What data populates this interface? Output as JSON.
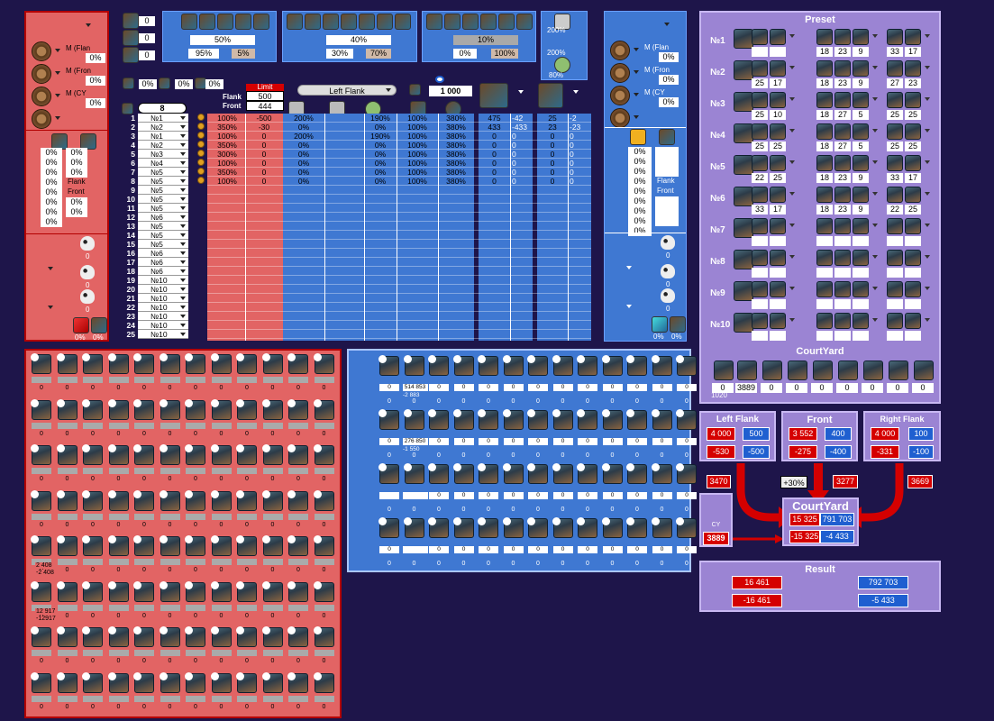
{
  "left_top": {
    "rows": [
      {
        "label": "M (Flan",
        "value": "0%"
      },
      {
        "label": "M (Fron",
        "value": "0%"
      },
      {
        "label": "M (CY",
        "value": "0%"
      }
    ]
  },
  "left_mid": {
    "rows": [
      "0%",
      "0%",
      "0%",
      "0%",
      "0%",
      "0%",
      "0%",
      "0%"
    ],
    "col2": [
      "0%",
      "0%",
      "0%",
      "Flank",
      "Front",
      "0%",
      "0%"
    ]
  },
  "left_bottom": {
    "values": [
      "0",
      "0",
      "0"
    ],
    "pcts": [
      "0%",
      "0%"
    ]
  },
  "top_counts": [
    "0",
    "0",
    "0"
  ],
  "boost": [
    {
      "pct": "50%",
      "a": "95%",
      "b": "5%"
    },
    {
      "pct": "40%",
      "a": "30%",
      "b": "70%"
    },
    {
      "pct": "10%",
      "a": "0%",
      "b": "100%"
    }
  ],
  "wall": {
    "a": "200%",
    "b": "200%",
    "c": "80%"
  },
  "small_pcts": [
    "0%",
    "0%",
    "0%",
    "0%"
  ],
  "limit": {
    "label": "Limit",
    "flank_label": "Flank",
    "flank": "500",
    "front_label": "Front",
    "front": "444"
  },
  "selector": {
    "num": "8",
    "flank": "Left Flank",
    "amount": "1 000"
  },
  "table": {
    "rows": [
      "1",
      "2",
      "3",
      "4",
      "5",
      "6",
      "7",
      "8",
      "9",
      "10",
      "11",
      "12",
      "13",
      "14",
      "15",
      "16",
      "17",
      "18",
      "19",
      "20",
      "21",
      "22",
      "23",
      "24",
      "25"
    ],
    "presets": [
      "№1",
      "№2",
      "№1",
      "№2",
      "№3",
      "№4",
      "№5",
      "№5",
      "№5",
      "№5",
      "№5",
      "№6",
      "№5",
      "№5",
      "№5",
      "№6",
      "№6",
      "№6",
      "№10",
      "№10",
      "№10",
      "№10",
      "№10",
      "№10",
      "№10"
    ],
    "c1": [
      "100%",
      "350%",
      "100%",
      "350%",
      "300%",
      "100%",
      "350%",
      "100%"
    ],
    "c2": [
      "-500",
      "-30",
      "0",
      "0",
      "0",
      "0",
      "0",
      "0"
    ],
    "c3": [
      "200%",
      "0%",
      "200%",
      "0%",
      "0%",
      "0%",
      "0%",
      "0%"
    ],
    "c4": [
      "190%",
      "0%",
      "190%",
      "0%",
      "0%",
      "0%",
      "0%",
      "0%"
    ],
    "c5": [
      "100%",
      "100%",
      "100%",
      "100%",
      "100%",
      "100%",
      "100%",
      "100%"
    ],
    "c6": [
      "380%",
      "380%",
      "380%",
      "380%",
      "380%",
      "380%",
      "380%",
      "380%"
    ],
    "c7": [
      "475",
      "433",
      "0",
      "0",
      "0",
      "0",
      "0",
      "0"
    ],
    "c8": [
      "-42",
      "-433",
      "0",
      "0",
      "0",
      "0",
      "0",
      "0"
    ],
    "c9": [
      "25",
      "23",
      "0",
      "0",
      "0",
      "0",
      "0",
      "0"
    ],
    "c10": [
      "-2",
      "-23",
      "0",
      "0",
      "0",
      "0",
      "0",
      "0"
    ]
  },
  "right_small": {
    "rows": [
      {
        "label": "M (Flan",
        "value": "0%"
      },
      {
        "label": "M (Fron",
        "value": "0%"
      },
      {
        "label": "M (CY",
        "value": "0%"
      }
    ],
    "mid": [
      "0%",
      "0%",
      "0%",
      "0%",
      "0%",
      "0%",
      "0%",
      "0%",
      "0%"
    ],
    "mid2": [
      "",
      "",
      "",
      "Flank",
      "Front",
      "",
      "",
      ""
    ],
    "bottom": [
      "0",
      "0",
      "0"
    ],
    "pcts": [
      "0%",
      "0%"
    ]
  },
  "preset": {
    "title": "Preset",
    "rows": [
      {
        "name": "№1",
        "a": [
          "",
          ""
        ],
        "b": [
          "18",
          "23",
          "9"
        ],
        "c": [
          "33",
          "17"
        ]
      },
      {
        "name": "№2",
        "a": [
          "25",
          "17"
        ],
        "b": [
          "18",
          "23",
          "9"
        ],
        "c": [
          "27",
          "23"
        ]
      },
      {
        "name": "№3",
        "a": [
          "25",
          "10"
        ],
        "b": [
          "18",
          "27",
          "5"
        ],
        "c": [
          "25",
          "25"
        ]
      },
      {
        "name": "№4",
        "a": [
          "25",
          "25"
        ],
        "b": [
          "18",
          "27",
          "5"
        ],
        "c": [
          "25",
          "25"
        ]
      },
      {
        "name": "№5",
        "a": [
          "22",
          "25"
        ],
        "b": [
          "18",
          "23",
          "9"
        ],
        "c": [
          "33",
          "17"
        ]
      },
      {
        "name": "№6",
        "a": [
          "33",
          "17"
        ],
        "b": [
          "18",
          "23",
          "9"
        ],
        "c": [
          "22",
          "25"
        ]
      },
      {
        "name": "№7",
        "a": [
          "",
          ""
        ],
        "b": [
          "",
          "",
          ""
        ],
        "c": [
          "",
          ""
        ]
      },
      {
        "name": "№8",
        "a": [
          "",
          ""
        ],
        "b": [
          "",
          "",
          ""
        ],
        "c": [
          "",
          ""
        ]
      },
      {
        "name": "№9",
        "a": [
          "",
          ""
        ],
        "b": [
          "",
          "",
          ""
        ],
        "c": [
          "",
          ""
        ]
      },
      {
        "name": "№10",
        "a": [
          "",
          ""
        ],
        "b": [
          "",
          "",
          ""
        ],
        "c": [
          "",
          ""
        ]
      }
    ],
    "courtyard_title": "CourtYard",
    "courtyard_vals": [
      "0",
      "1020",
      "3889",
      "0",
      "0",
      "0",
      "0",
      "0",
      "0",
      "0"
    ]
  },
  "battle": {
    "left": {
      "title": "Left Flank",
      "r1": "4 000",
      "b1": "500",
      "r2": "-530",
      "b2": "-500"
    },
    "front": {
      "title": "Front",
      "r1": "3 552",
      "b1": "400",
      "r2": "-275",
      "b2": "-400"
    },
    "right": {
      "title": "Right Flank",
      "r1": "4 000",
      "b1": "100",
      "r2": "-331",
      "b2": "-100"
    },
    "side_left": "3470",
    "side_mid": "3277",
    "side_right": "3669",
    "bonus": "+30%",
    "cy_label": "CY",
    "cy_value": "3889",
    "courtyard": {
      "title": "CourtYard",
      "r1": "15 325",
      "b1": "791 703",
      "r2": "-15 325",
      "b2": "-4 433"
    },
    "result": {
      "title": "Result",
      "r1": "16 461",
      "b1": "792 703",
      "r2": "-16 461",
      "b2": "-5 433"
    }
  },
  "blue_grid": {
    "row1": [
      "0",
      "514 853",
      "0",
      "0",
      "0",
      "0",
      "0",
      "0",
      "0",
      "0",
      "0",
      "0",
      "0"
    ],
    "row1b": "-2 883",
    "row2": [
      "0",
      "276 850",
      "0",
      "0",
      "0",
      "0",
      "0",
      "0",
      "0",
      "0",
      "0",
      "0",
      "0"
    ],
    "row2b": "-1 550",
    "row3": [
      "",
      "",
      "0",
      "0",
      "0",
      "0",
      "0",
      "0",
      "0",
      "0",
      "0",
      "0",
      "0"
    ],
    "row4": [
      "0",
      "",
      "0",
      "0",
      "0",
      "0",
      "0",
      "0",
      "0",
      "0",
      "0",
      "0",
      "0"
    ]
  },
  "red_grid": {
    "extra1": [
      "2 408",
      "-2 408"
    ],
    "extra2": [
      "12 917",
      "-12917"
    ]
  },
  "colors": {
    "bg": "#1e154a",
    "red": "#e26464",
    "blue": "#3f78d2",
    "purple": "#9b84d3"
  }
}
